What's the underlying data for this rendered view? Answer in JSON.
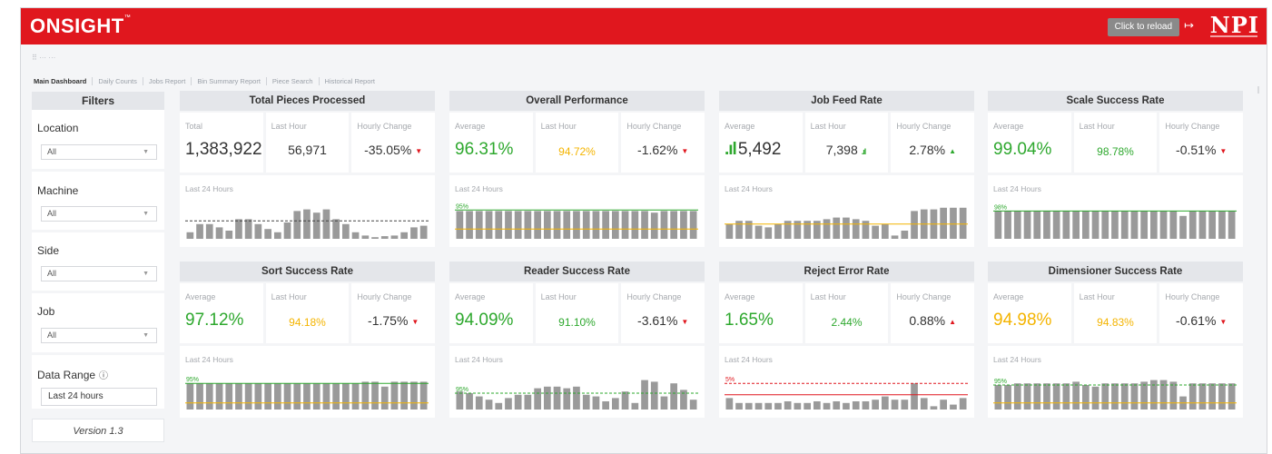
{
  "header": {
    "logo": "ONSIGHT",
    "logo_tm": "™",
    "reload_label": "Click to reload",
    "brand": "NPI"
  },
  "subheader": {
    "text": "⠿ ··· ···"
  },
  "tabs": [
    "Main Dashboard",
    "Daily Counts",
    "Jobs Report",
    "Bin Summary Report",
    "Piece Search",
    "Historical Report"
  ],
  "sidebar": {
    "title": "Filters",
    "filters": [
      {
        "label": "Location",
        "value": "All"
      },
      {
        "label": "Machine",
        "value": "All"
      },
      {
        "label": "Side",
        "value": "All"
      },
      {
        "label": "Job",
        "value": "All"
      }
    ],
    "date_range_label": "Data Range",
    "date_range_value": "Last 24 hours",
    "version": "Version 1.3"
  },
  "spark_label": "Last 24 Hours",
  "colors": {
    "red": "#e0171e",
    "green": "#2ea82e",
    "amber": "#f4b400",
    "bar": "#9a9a9a"
  },
  "cards": [
    {
      "title": "Total Pieces Processed",
      "m1_label": "Total",
      "m1_value": "1,383,922",
      "m1_color": "default",
      "m2_label": "Last Hour",
      "m2_value": "56,971",
      "m2_color": "default",
      "m3_label": "Hourly Change",
      "m3_value": "-35.05%",
      "m3_trend": "down-red",
      "bars": [
        0.2,
        0.45,
        0.45,
        0.35,
        0.25,
        0.6,
        0.6,
        0.45,
        0.3,
        0.2,
        0.5,
        0.85,
        0.9,
        0.8,
        0.9,
        0.6,
        0.45,
        0.2,
        0.1,
        0.05,
        0.08,
        0.1,
        0.2,
        0.35,
        0.4
      ],
      "target": 0.55,
      "target_color": "dark",
      "target_style": "dashed",
      "target_label": ""
    },
    {
      "title": "Overall Performance",
      "m1_label": "Average",
      "m1_value": "96.31%",
      "m1_color": "green",
      "m2_label": "Last Hour",
      "m2_value": "94.72%",
      "m2_color": "amber",
      "m3_label": "Hourly Change",
      "m3_value": "-1.62%",
      "m3_trend": "down-red",
      "bars": [
        0.85,
        0.85,
        0.85,
        0.85,
        0.85,
        0.85,
        0.85,
        0.85,
        0.85,
        0.85,
        0.85,
        0.85,
        0.85,
        0.85,
        0.85,
        0.85,
        0.85,
        0.85,
        0.85,
        0.85,
        0.8,
        0.85,
        0.85,
        0.85,
        0.85
      ],
      "target": 0.88,
      "target_color": "green",
      "target_style": "solid",
      "target_label": "95%",
      "target2": 0.3
    },
    {
      "title": "Job Feed Rate",
      "m1_label": "Average",
      "m1_value": "5,492",
      "m1_color": "default",
      "m1_signal": true,
      "m2_label": "Last Hour",
      "m2_value": "7,398",
      "m2_color": "default",
      "m2_signal": true,
      "m3_label": "Hourly Change",
      "m3_value": "2.78%",
      "m3_trend": "up-green",
      "bars": [
        0.45,
        0.55,
        0.55,
        0.4,
        0.35,
        0.45,
        0.55,
        0.55,
        0.55,
        0.55,
        0.6,
        0.65,
        0.65,
        0.6,
        0.55,
        0.4,
        0.45,
        0.1,
        0.25,
        0.85,
        0.9,
        0.9,
        0.95,
        0.95,
        0.95
      ],
      "target": 0.45,
      "target_color": "amber",
      "target_style": "solid",
      "target_label": ""
    },
    {
      "title": "Scale Success Rate",
      "m1_label": "Average",
      "m1_value": "99.04%",
      "m1_color": "green",
      "m2_label": "Last Hour",
      "m2_value": "98.78%",
      "m2_color": "green-small",
      "m3_label": "Hourly Change",
      "m3_value": "-0.51%",
      "m3_trend": "down-red",
      "bars": [
        0.85,
        0.85,
        0.85,
        0.85,
        0.85,
        0.85,
        0.85,
        0.85,
        0.85,
        0.85,
        0.85,
        0.85,
        0.85,
        0.85,
        0.85,
        0.85,
        0.85,
        0.85,
        0.85,
        0.7,
        0.85,
        0.85,
        0.85,
        0.85,
        0.85
      ],
      "target": 0.85,
      "target_color": "green",
      "target_style": "solid",
      "target_label": "98%"
    },
    {
      "title": "Sort Success Rate",
      "m1_label": "Average",
      "m1_value": "97.12%",
      "m1_color": "green",
      "m2_label": "Last Hour",
      "m2_value": "94.18%",
      "m2_color": "amber",
      "m3_label": "Hourly Change",
      "m3_value": "-1.75%",
      "m3_trend": "down-red",
      "bars": [
        0.8,
        0.8,
        0.8,
        0.8,
        0.8,
        0.8,
        0.8,
        0.8,
        0.8,
        0.8,
        0.8,
        0.8,
        0.8,
        0.8,
        0.8,
        0.8,
        0.8,
        0.8,
        0.85,
        0.85,
        0.7,
        0.85,
        0.85,
        0.85,
        0.85
      ],
      "target": 0.8,
      "target_color": "green",
      "target_style": "solid",
      "target_label": "95%",
      "target2": 0.2
    },
    {
      "title": "Reader Success Rate",
      "m1_label": "Average",
      "m1_value": "94.09%",
      "m1_color": "green",
      "m2_label": "Last Hour",
      "m2_value": "91.10%",
      "m2_color": "green-small",
      "m3_label": "Hourly Change",
      "m3_value": "-3.61%",
      "m3_trend": "down-red",
      "bars": [
        0.55,
        0.5,
        0.4,
        0.3,
        0.2,
        0.35,
        0.45,
        0.45,
        0.65,
        0.7,
        0.7,
        0.65,
        0.7,
        0.45,
        0.4,
        0.25,
        0.35,
        0.55,
        0.2,
        0.9,
        0.85,
        0.4,
        0.8,
        0.6,
        0.3
      ],
      "target": 0.5,
      "target_color": "green",
      "target_style": "dashed",
      "target_label": "95%"
    },
    {
      "title": "Reject Error Rate",
      "m1_label": "Average",
      "m1_value": "1.65%",
      "m1_color": "green",
      "m2_label": "Last Hour",
      "m2_value": "2.44%",
      "m2_color": "green-small",
      "m3_label": "Hourly Change",
      "m3_value": "0.88%",
      "m3_trend": "up-red",
      "bars": [
        0.35,
        0.2,
        0.2,
        0.2,
        0.2,
        0.2,
        0.25,
        0.2,
        0.2,
        0.25,
        0.2,
        0.25,
        0.2,
        0.25,
        0.25,
        0.3,
        0.4,
        0.3,
        0.3,
        0.8,
        0.35,
        0.1,
        0.3,
        0.15,
        0.35
      ],
      "target": 0.8,
      "target_color": "red",
      "target_style": "dashed",
      "target_label": "5%",
      "target2": 0.45
    },
    {
      "title": "Dimensioner Success Rate",
      "m1_label": "Average",
      "m1_value": "94.98%",
      "m1_color": "amber",
      "m2_label": "Last Hour",
      "m2_value": "94.83%",
      "m2_color": "amber",
      "m3_label": "Hourly Change",
      "m3_value": "-0.61%",
      "m3_trend": "down-red",
      "bars": [
        0.75,
        0.75,
        0.8,
        0.8,
        0.8,
        0.8,
        0.8,
        0.8,
        0.85,
        0.75,
        0.7,
        0.8,
        0.8,
        0.8,
        0.8,
        0.85,
        0.9,
        0.9,
        0.85,
        0.4,
        0.8,
        0.8,
        0.8,
        0.8,
        0.8
      ],
      "target": 0.75,
      "target_color": "green",
      "target_style": "dashed",
      "target_label": "95%",
      "target2": 0.2
    }
  ]
}
